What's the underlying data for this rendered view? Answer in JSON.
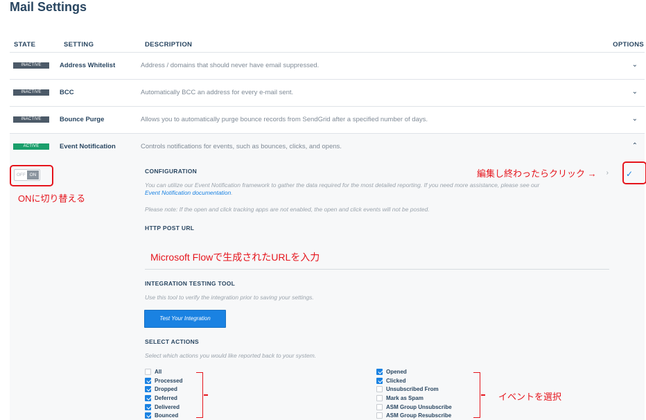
{
  "page": {
    "title": "Mail Settings"
  },
  "columns": {
    "state": "STATE",
    "setting": "SETTING",
    "description": "DESCRIPTION",
    "options": "OPTIONS"
  },
  "rows": [
    {
      "state": "INACTIVE",
      "name": "Address Whitelist",
      "description": "Address / domains that should never have email suppressed."
    },
    {
      "state": "INACTIVE",
      "name": "BCC",
      "description": "Automatically BCC an address for every e-mail sent."
    },
    {
      "state": "INACTIVE",
      "name": "Bounce Purge",
      "description": "Allows you to automatically purge bounce records from SendGrid after a specified number of days."
    },
    {
      "state": "ACTIVE",
      "name": "Event Notification",
      "description": "Controls notifications for events, such as bounces, clicks, and opens."
    }
  ],
  "toggle": {
    "off": "OFF",
    "on": "ON"
  },
  "config": {
    "heading": "CONFIGURATION",
    "text1": "You can utilize our Event Notification framework to gather the data required for the most detailed reporting. If you need more assistance, please see our",
    "link": "Event Notification documentation",
    "link_suffix": ".",
    "text2": "Please note: If the open and click tracking apps are not enabled, the open and click events will not be posted."
  },
  "http_post": {
    "heading": "HTTP POST URL",
    "value": ""
  },
  "testing": {
    "heading": "INTEGRATION TESTING TOOL",
    "text": "Use this tool to verify the integration prior to saving your settings.",
    "button": "Test Your Integration"
  },
  "actions": {
    "heading": "SELECT ACTIONS",
    "text": "Select which actions you would like reported back to your system.",
    "left": [
      {
        "label": "All",
        "checked": false
      },
      {
        "label": "Processed",
        "checked": true
      },
      {
        "label": "Dropped",
        "checked": true
      },
      {
        "label": "Deferred",
        "checked": true
      },
      {
        "label": "Delivered",
        "checked": true
      },
      {
        "label": "Bounced",
        "checked": true
      }
    ],
    "right": [
      {
        "label": "Opened",
        "checked": true
      },
      {
        "label": "Clicked",
        "checked": true
      },
      {
        "label": "Unsubscribed From",
        "checked": false
      },
      {
        "label": "Mark as Spam",
        "checked": false
      },
      {
        "label": "ASM Group Unsubscribe",
        "checked": false
      },
      {
        "label": "ASM Group Resubscribe",
        "checked": false
      }
    ]
  },
  "annotations": {
    "toggle_note": "ONに切り替える",
    "save_note": "編集し終わったらクリック →",
    "url_note": "Microsoft Flowで生成されたURLを入力",
    "events_note": "イベントを選択"
  },
  "icons": {
    "expand": "chevron-down-icon",
    "collapse": "chevron-up-icon",
    "save": "checkmark-icon",
    "side": "chevron-right-icon"
  },
  "colors": {
    "accent": "#1a82e2",
    "active": "#1a9f6b",
    "inactive": "#4c5a68",
    "annotation": "#e5141c"
  }
}
